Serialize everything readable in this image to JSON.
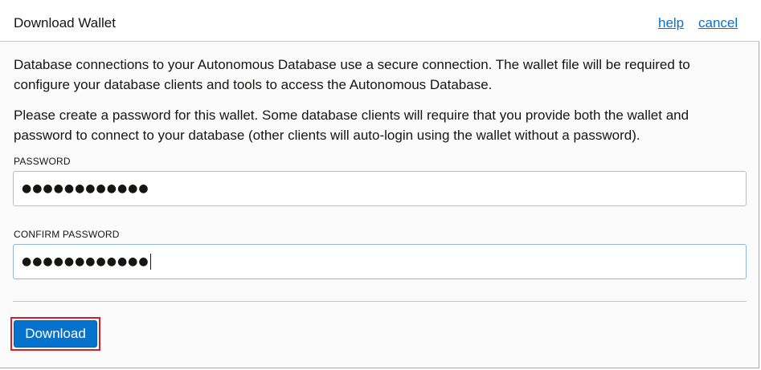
{
  "dialog": {
    "title": "Download Wallet",
    "help_label": "help",
    "cancel_label": "cancel",
    "description_1": "Database connections to your Autonomous Database use a secure connection. The wallet file will be required to configure your database clients and tools to access the Autonomous Database.",
    "description_2": "Please create a password for this wallet. Some database clients will require that you provide both the wallet and password to connect to your database (other clients will auto-login using the wallet without a password).",
    "password": {
      "label": "PASSWORD",
      "value": "●●●●●●●●●●●●"
    },
    "confirm_password": {
      "label": "CONFIRM PASSWORD",
      "value": "●●●●●●●●●●●●"
    },
    "download_label": "Download"
  },
  "colors": {
    "link": "#0572ce",
    "primary_button": "#0572ce",
    "highlight_border": "#d21f2a"
  }
}
